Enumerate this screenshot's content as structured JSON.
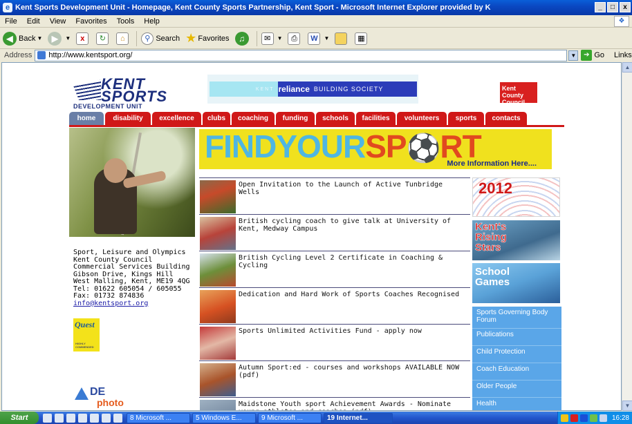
{
  "window": {
    "title": "Kent Sports Development Unit - Homepage, Kent County Sports Partnership, Kent Sport - Microsoft Internet Explorer provided by K",
    "controls": [
      "_",
      "□",
      "x"
    ]
  },
  "menu": [
    "File",
    "Edit",
    "View",
    "Favorites",
    "Tools",
    "Help"
  ],
  "toolbar": {
    "back": "Back",
    "search": "Search",
    "favorites": "Favorites"
  },
  "addressbar": {
    "label": "Address",
    "url": "http://www.kentsport.org/",
    "go": "Go",
    "links": "Links"
  },
  "page": {
    "logo": {
      "line1": "KENT",
      "line2": "SPORTS",
      "line3": "DEVELOPMENT UNIT"
    },
    "banner": {
      "kent": "KENT",
      "reliance": "reliance",
      "society": "BUILDING SOCIETY"
    },
    "council": "Kent County Council",
    "nav": [
      {
        "label": "home",
        "active": true
      },
      {
        "label": "disability"
      },
      {
        "label": "excellence"
      },
      {
        "label": "clubs"
      },
      {
        "label": "coaching"
      },
      {
        "label": "funding"
      },
      {
        "label": "schools"
      },
      {
        "label": "facilities"
      },
      {
        "label": "volunteers"
      },
      {
        "label": "sports"
      },
      {
        "label": "contacts"
      }
    ],
    "address": {
      "line1": "Sport, Leisure and Olympics",
      "line2": "Kent County Council",
      "line3": "Commercial Services Building",
      "line4": "Gibson Drive, Kings Hill",
      "line5": "West Malling, Kent, ME19 4QG",
      "line6": "Tel: 01622 605054 / 605055",
      "line7": "Fax: 01732 874836",
      "email": "info@kentsport.org"
    },
    "quest": {
      "name": "Quest",
      "sub": "HIGHLY COMMENDED"
    },
    "dephoto": {
      "de": "DE",
      "photo": "photo"
    },
    "findyoursport": {
      "part1": "FINDYOUR",
      "part2": "SP",
      "part3": "RT",
      "more": "More Information Here...."
    },
    "news": [
      "Open Invitation to the Launch of Active Tunbridge Wells",
      "British cycling coach to give talk at University of Kent, Medway Campus",
      "British Cycling Level 2 Certificate in Coaching & Cycling",
      "Dedication and Hard Work of Sports Coaches Recognised",
      "Sports Unlimited Activities Fund - apply now",
      "Autumn Sport:ed - courses and workshops AVAILABLE NOW (pdf)",
      "Maidstone Youth sport Achievement Awards - Nominate young athletes and coaches (pdf)"
    ],
    "promos": {
      "y2012": "2012",
      "rising": [
        "Kent's",
        "Rising",
        "Stars"
      ],
      "school": [
        "School",
        "Games"
      ]
    },
    "sidemenu": [
      "Sports Governing Body Forum",
      "Publications",
      "Child Protection",
      "Coach Education",
      "Older People",
      "Health"
    ]
  },
  "taskbar": {
    "start": "Start",
    "tasks": [
      {
        "label": "8 Microsoft ..."
      },
      {
        "label": "5 Windows E..."
      },
      {
        "label": "9 Microsoft ..."
      },
      {
        "label": "19 Internet...",
        "active": true
      }
    ],
    "clock": "16:28"
  }
}
